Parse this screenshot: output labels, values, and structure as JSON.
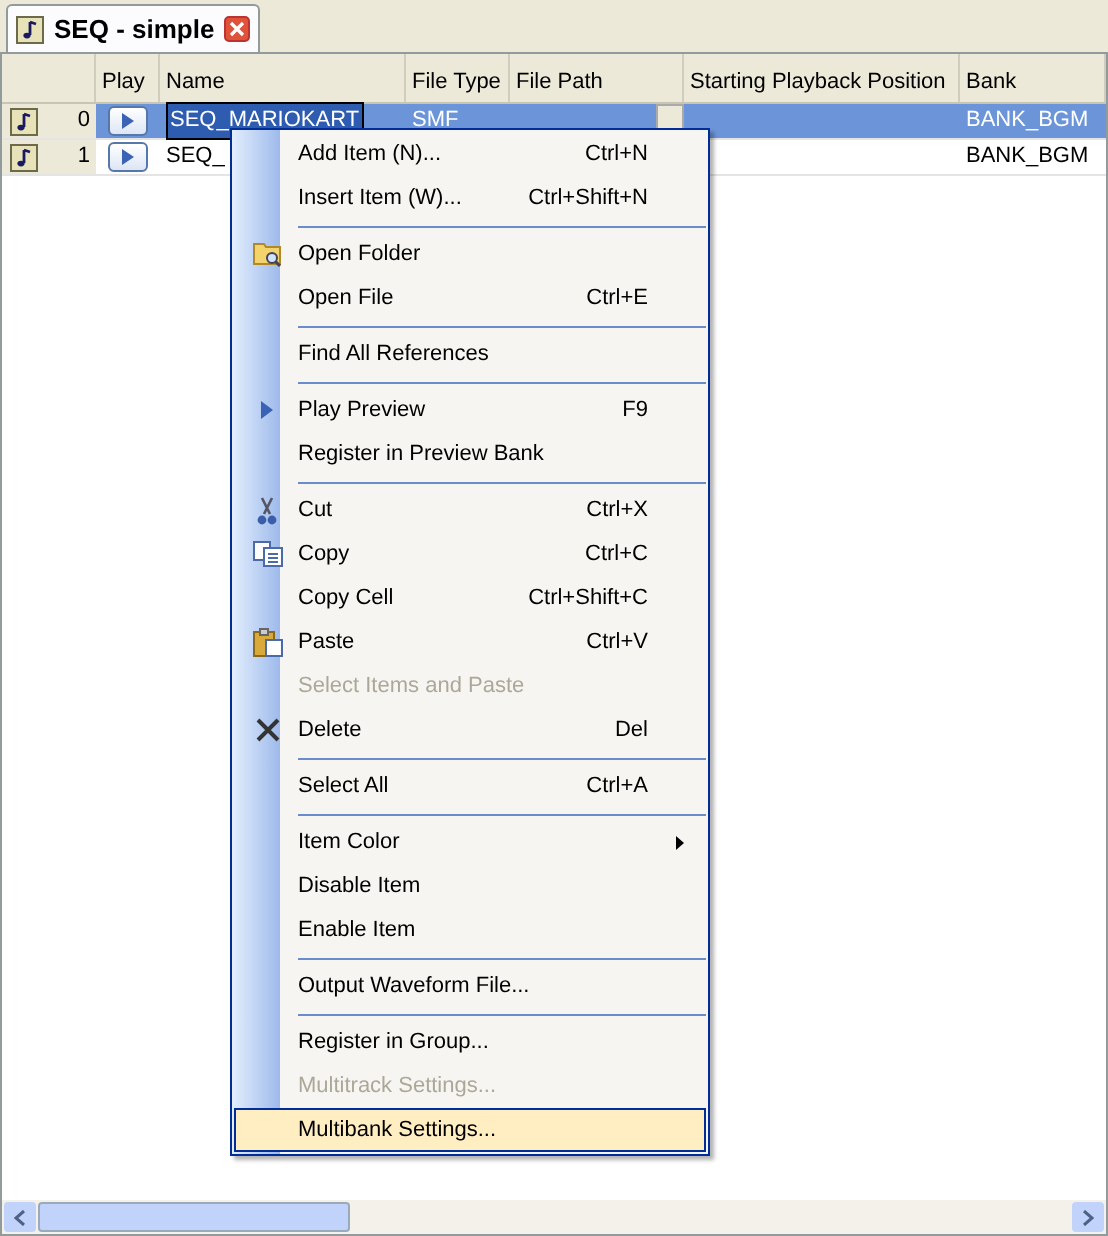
{
  "tab": {
    "title": "SEQ - simple"
  },
  "table": {
    "columns": [
      "Play",
      "Name",
      "File Type",
      "File Path",
      "Starting Playback Position",
      "Bank"
    ],
    "rows": [
      {
        "index": "0",
        "name": "SEQ_MARIOKART",
        "file_type": "SMF",
        "bank": "BANK_BGM",
        "selected": true
      },
      {
        "index": "1",
        "name": "SEQ_",
        "bank": "BANK_BGM",
        "selected": false
      }
    ]
  },
  "context_menu": {
    "items": [
      {
        "kind": "item",
        "label": "Add Item (N)...",
        "shortcut": "Ctrl+N",
        "disabled": false,
        "selected": false
      },
      {
        "kind": "item",
        "label": "Insert Item (W)...",
        "shortcut": "Ctrl+Shift+N",
        "disabled": false,
        "selected": false
      },
      {
        "kind": "separator"
      },
      {
        "kind": "item",
        "label": "Open Folder",
        "disabled": false,
        "selected": false
      },
      {
        "kind": "item",
        "label": "Open File",
        "shortcut": "Ctrl+E",
        "disabled": false,
        "selected": false
      },
      {
        "kind": "separator"
      },
      {
        "kind": "item",
        "label": "Find All References",
        "disabled": false,
        "selected": false
      },
      {
        "kind": "separator"
      },
      {
        "kind": "item",
        "label": "Play Preview",
        "shortcut": "F9",
        "disabled": false,
        "selected": false
      },
      {
        "kind": "item",
        "label": "Register in Preview Bank",
        "disabled": false,
        "selected": false
      },
      {
        "kind": "separator"
      },
      {
        "kind": "item",
        "label": "Cut",
        "shortcut": "Ctrl+X",
        "disabled": false,
        "selected": false
      },
      {
        "kind": "item",
        "label": "Copy",
        "shortcut": "Ctrl+C",
        "disabled": false,
        "selected": false
      },
      {
        "kind": "item",
        "label": "Copy Cell",
        "shortcut": "Ctrl+Shift+C",
        "disabled": false,
        "selected": false
      },
      {
        "kind": "item",
        "label": "Paste",
        "shortcut": "Ctrl+V",
        "disabled": false,
        "selected": false
      },
      {
        "kind": "item",
        "label": "Select Items and Paste",
        "disabled": true,
        "selected": false
      },
      {
        "kind": "item",
        "label": "Delete",
        "shortcut": "Del",
        "disabled": false,
        "selected": false
      },
      {
        "kind": "separator"
      },
      {
        "kind": "item",
        "label": "Select All",
        "shortcut": "Ctrl+A",
        "disabled": false,
        "selected": false
      },
      {
        "kind": "separator"
      },
      {
        "kind": "item",
        "label": "Item Color",
        "submenu": true,
        "disabled": false,
        "selected": false
      },
      {
        "kind": "item",
        "label": "Disable Item",
        "disabled": false,
        "selected": false
      },
      {
        "kind": "item",
        "label": "Enable Item",
        "disabled": false,
        "selected": false
      },
      {
        "kind": "separator"
      },
      {
        "kind": "item",
        "label": "Output Waveform File...",
        "disabled": false,
        "selected": false
      },
      {
        "kind": "separator"
      },
      {
        "kind": "item",
        "label": "Register in Group...",
        "disabled": false,
        "selected": false
      },
      {
        "kind": "item",
        "label": "Multitrack Settings...",
        "disabled": true,
        "selected": false
      },
      {
        "kind": "item",
        "label": "Multibank Settings...",
        "disabled": false,
        "selected": true
      }
    ]
  }
}
